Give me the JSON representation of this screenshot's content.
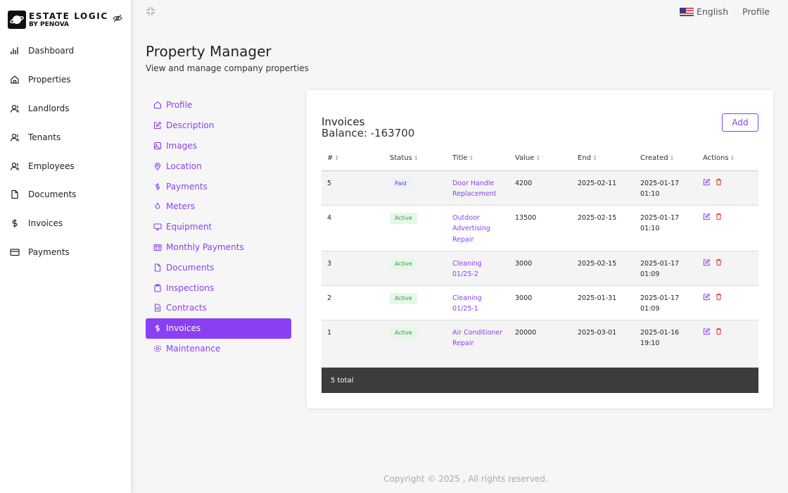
{
  "brand": {
    "line1": "ESTATE LOGIC",
    "line2": "BY PENOVA"
  },
  "sidebar": {
    "items": [
      {
        "label": "Dashboard",
        "icon": "bar-chart-icon"
      },
      {
        "label": "Properties",
        "icon": "home-icon"
      },
      {
        "label": "Landlords",
        "icon": "user-icon"
      },
      {
        "label": "Tenants",
        "icon": "user-icon"
      },
      {
        "label": "Employees",
        "icon": "users-icon"
      },
      {
        "label": "Documents",
        "icon": "file-icon"
      },
      {
        "label": "Invoices",
        "icon": "dollar-icon"
      },
      {
        "label": "Payments",
        "icon": "credit-card-icon"
      }
    ]
  },
  "topbar": {
    "language": "English",
    "profile": "Profile"
  },
  "header": {
    "title": "Property Manager",
    "subtitle": "View and manage company properties"
  },
  "submenu": {
    "active_index": 11,
    "items": [
      {
        "label": "Profile",
        "icon": "home-icon"
      },
      {
        "label": "Description",
        "icon": "edit-icon"
      },
      {
        "label": "Images",
        "icon": "image-icon"
      },
      {
        "label": "Location",
        "icon": "map-pin-icon"
      },
      {
        "label": "Payments",
        "icon": "dollar-icon"
      },
      {
        "label": "Meters",
        "icon": "droplet-icon"
      },
      {
        "label": "Equipment",
        "icon": "monitor-icon"
      },
      {
        "label": "Monthly Payments",
        "icon": "calendar-icon"
      },
      {
        "label": "Documents",
        "icon": "file-icon"
      },
      {
        "label": "Inspections",
        "icon": "clipboard-icon"
      },
      {
        "label": "Contracts",
        "icon": "file-text-icon"
      },
      {
        "label": "Invoices",
        "icon": "dollar-icon"
      },
      {
        "label": "Maintenance",
        "icon": "settings-icon"
      }
    ]
  },
  "invoices": {
    "title": "Invoices",
    "balance": "Balance: -163700",
    "add_label": "Add",
    "columns": [
      "#",
      "Status",
      "Title",
      "Value",
      "End",
      "Created",
      "Actions"
    ],
    "rows": [
      {
        "id": "5",
        "status": "Paid",
        "title": "Door Handle Replacement",
        "value": "4200",
        "end": "2025-02-11",
        "created": "2025-01-17 01:10"
      },
      {
        "id": "4",
        "status": "Active",
        "title": "Outdoor Advertising Repair",
        "value": "13500",
        "end": "2025-02-15",
        "created": "2025-01-17 01:10"
      },
      {
        "id": "3",
        "status": "Active",
        "title": "Cleaning 01/25-2",
        "value": "3000",
        "end": "2025-02-15",
        "created": "2025-01-17 01:09"
      },
      {
        "id": "2",
        "status": "Active",
        "title": "Cleaning 01/25-1",
        "value": "3000",
        "end": "2025-01-31",
        "created": "2025-01-17 01:09"
      },
      {
        "id": "1",
        "status": "Active",
        "title": "Air Conditioner Repair",
        "value": "20000",
        "end": "2025-03-01",
        "created": "2025-01-16 19:10"
      }
    ],
    "total": "5 total"
  },
  "footer": {
    "copyright": "Copyright © 2025 , All rights reserved."
  },
  "colors": {
    "accent": "#8b3ff2",
    "paid": "#3a4fb0",
    "active": "#2f9e45"
  }
}
